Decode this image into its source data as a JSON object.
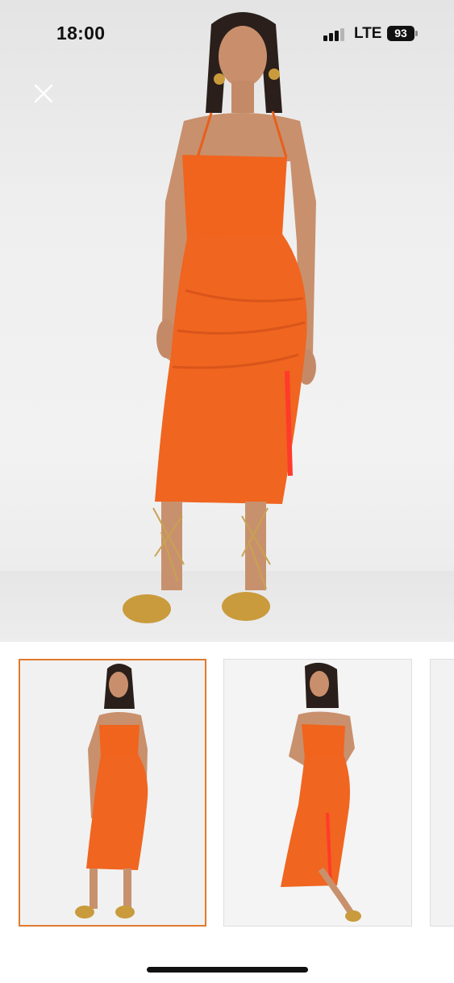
{
  "status_bar": {
    "time": "18:00",
    "network": "LTE",
    "battery_percent": "93",
    "signal_bars": 3
  },
  "icons": {
    "close": "close-icon"
  },
  "colors": {
    "dress": "#f0641e",
    "selected_thumbnail_border": "#e07b2e"
  },
  "gallery": {
    "thumbnail_count_visible": 3,
    "selected_index": 0
  }
}
